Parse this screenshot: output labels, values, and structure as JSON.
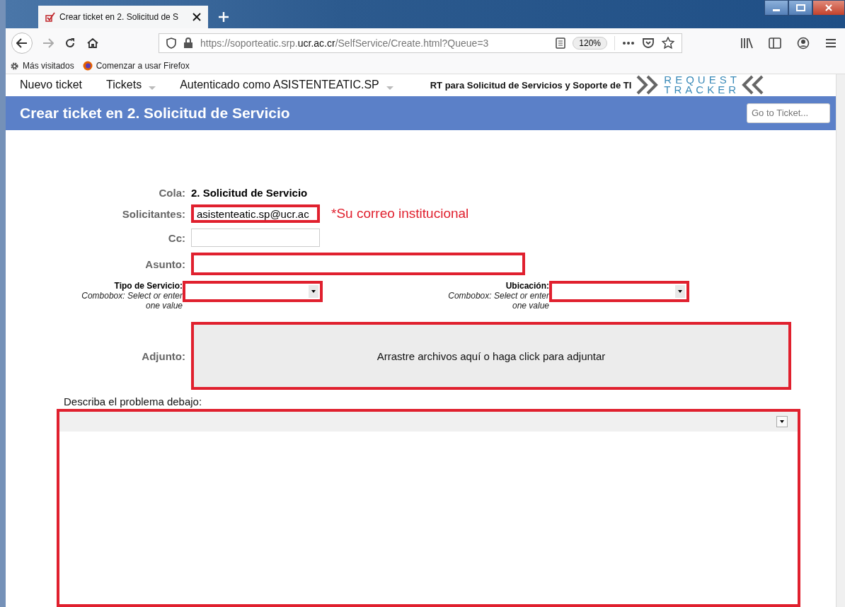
{
  "browser": {
    "tab_title": "Crear ticket en 2. Solicitud de S",
    "url_host_pre": "https://soporteatic.srp.",
    "url_host": "ucr.ac.cr",
    "url_path": "/SelfService/Create.html?Queue=3",
    "zoom": "120%",
    "bookmarks": [
      {
        "label": "Más visitados",
        "kind": "gear"
      },
      {
        "label": "Comenzar a usar Firefox",
        "kind": "firefox"
      }
    ]
  },
  "nav": {
    "items": [
      {
        "label": "Nuevo ticket",
        "dropdown": false
      },
      {
        "label": "Tickets",
        "dropdown": true
      },
      {
        "label": "Autenticado como ASISTENTEATIC.SP",
        "dropdown": true
      }
    ],
    "site_title": "RT para Solicitud de Servicios y Soporte de TI",
    "logo": [
      "REQUEST",
      "TRACKER"
    ]
  },
  "header": {
    "title": "Crear ticket en 2. Solicitud de Servicio",
    "search_placeholder": "Go to Ticket..."
  },
  "form": {
    "queue": {
      "label": "Cola:",
      "value": "2. Solicitud de Servicio"
    },
    "requestors": {
      "label": "Solicitantes:",
      "value": "asistenteatic.sp@ucr.ac",
      "note": "*Su correo institucional",
      "highlighted": true
    },
    "cc": {
      "label": "Cc:",
      "highlighted": false
    },
    "subject": {
      "label": "Asunto:",
      "highlighted": true
    },
    "custom_fields": [
      {
        "label": "Tipo de Servicio:",
        "hint": "Combobox: Select or enter one value",
        "highlighted": true
      },
      {
        "label": "Ubicación:",
        "hint": "Combobox: Select or enter one value",
        "highlighted": true
      }
    ],
    "attach": {
      "label": "Adjunto:",
      "text": "Arrastre archivos aquí o haga click para adjuntar",
      "highlighted": true
    },
    "description": {
      "label": "Describa el problema debajo:",
      "highlighted": true
    }
  }
}
